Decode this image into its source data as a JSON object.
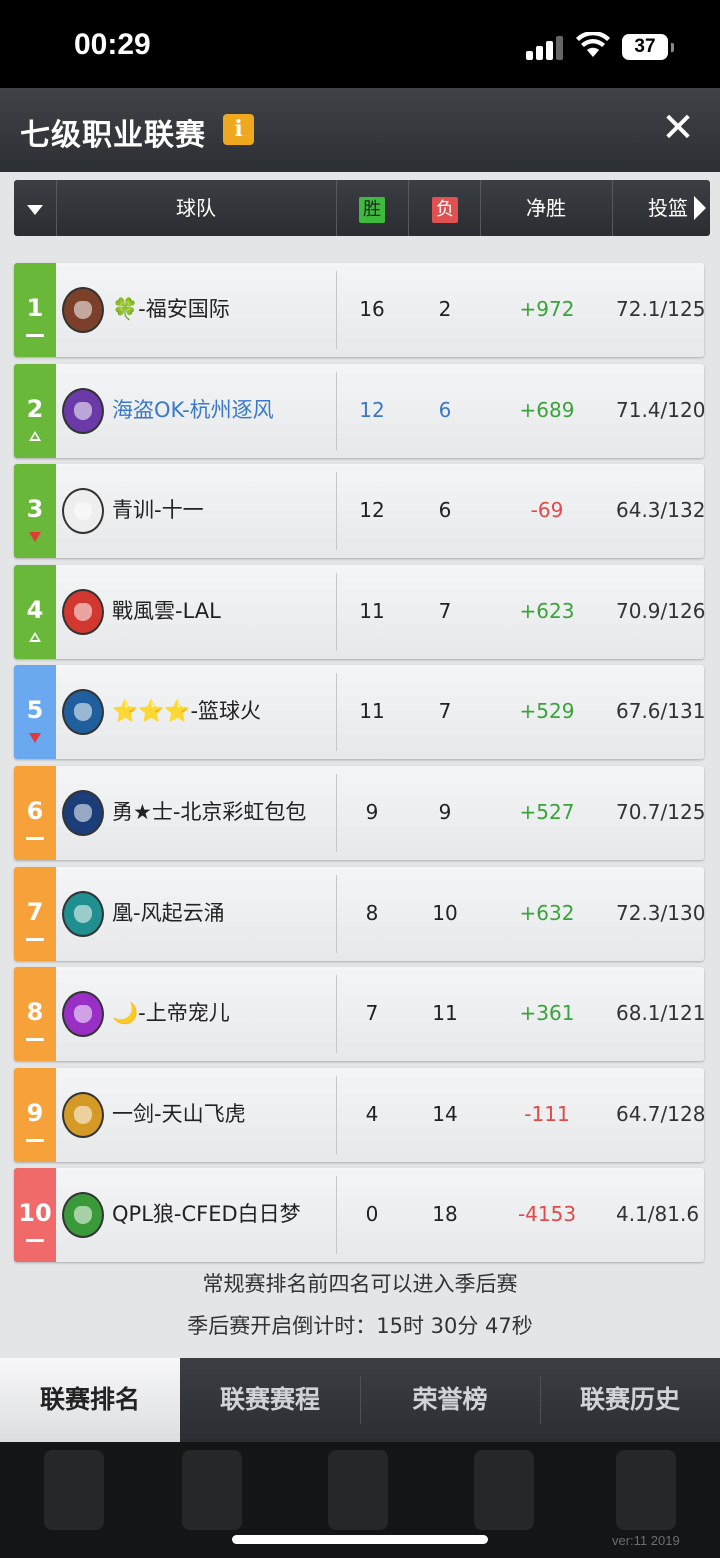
{
  "status_bar": {
    "time": "00:29",
    "battery": "37"
  },
  "header": {
    "title": "七级职业联赛",
    "info_label": "i",
    "close_label": "✕"
  },
  "columns": {
    "team": "球队",
    "win": "胜",
    "loss": "负",
    "net": "净胜",
    "shooting": "投篮"
  },
  "standings": [
    {
      "rank": "1",
      "team": "🍀-福安国际",
      "w": "16",
      "l": "2",
      "net": "+972",
      "shooting": "72.1/125",
      "rank_color": "#69b83a",
      "trend": "flat",
      "logo": "knight-helmet-icon",
      "logo_color": "#7b3f2a"
    },
    {
      "rank": "2",
      "team": "海盗OK-杭州逐风",
      "w": "12",
      "l": "6",
      "net": "+689",
      "shooting": "71.4/120",
      "rank_color": "#69b83a",
      "trend": "up",
      "logo": "dragon-icon",
      "logo_color": "#6a3aa8",
      "highlight": true
    },
    {
      "rank": "3",
      "team": "青训-十一",
      "w": "12",
      "l": "6",
      "net": "-69",
      "shooting": "64.3/132",
      "rank_color": "#69b83a",
      "trend": "down",
      "logo": "bear-icon",
      "logo_color": "#eeeeee"
    },
    {
      "rank": "4",
      "team": "戰風雲-LAL",
      "w": "11",
      "l": "7",
      "net": "+623",
      "shooting": "70.9/126",
      "rank_color": "#69b83a",
      "trend": "up",
      "logo": "dragon-head-icon",
      "logo_color": "#d2382f"
    },
    {
      "rank": "5",
      "team": "⭐⭐⭐-篮球火",
      "w": "11",
      "l": "7",
      "net": "+529",
      "shooting": "67.6/131",
      "rank_color": "#6aa8ef",
      "trend": "down",
      "logo": "winged-beast-icon",
      "logo_color": "#1f5f9e"
    },
    {
      "rank": "6",
      "team": "勇★士-北京彩虹包包",
      "w": "9",
      "l": "9",
      "net": "+527",
      "shooting": "70.7/125",
      "rank_color": "#f7a13a",
      "trend": "flat",
      "logo": "spartan-helmet-icon",
      "logo_color": "#1b3d7a"
    },
    {
      "rank": "7",
      "team": "凰-风起云涌",
      "w": "8",
      "l": "10",
      "net": "+632",
      "shooting": "72.3/130",
      "rank_color": "#f7a13a",
      "trend": "flat",
      "logo": "wolf-icon",
      "logo_color": "#1f8f8f"
    },
    {
      "rank": "8",
      "team": "🌙-上帝宠儿",
      "w": "7",
      "l": "11",
      "net": "+361",
      "shooting": "68.1/121",
      "rank_color": "#f7a13a",
      "trend": "flat",
      "logo": "panther-icon",
      "logo_color": "#9a2fc8"
    },
    {
      "rank": "9",
      "team": "一剑-天山飞虎",
      "w": "4",
      "l": "14",
      "net": "-111",
      "shooting": "64.7/128",
      "rank_color": "#f7a13a",
      "trend": "flat",
      "logo": "tiger-icon",
      "logo_color": "#d49a25"
    },
    {
      "rank": "10",
      "team": "QPL狼-CFED白日梦",
      "w": "0",
      "l": "18",
      "net": "-4153",
      "shooting": "4.1/81.6",
      "rank_color": "#f06a6a",
      "trend": "flat",
      "logo": "boar-icon",
      "logo_color": "#3a9a3a"
    }
  ],
  "notes": {
    "playoff_rule": "常规赛排名前四名可以进入季后赛",
    "countdown": "季后赛开启倒计时：15时 30分 47秒"
  },
  "tabs": [
    {
      "label": "联赛排名",
      "active": true
    },
    {
      "label": "联赛赛程",
      "active": false
    },
    {
      "label": "荣誉榜",
      "active": false
    },
    {
      "label": "联赛历史",
      "active": false
    }
  ],
  "version": "ver:11  2019"
}
